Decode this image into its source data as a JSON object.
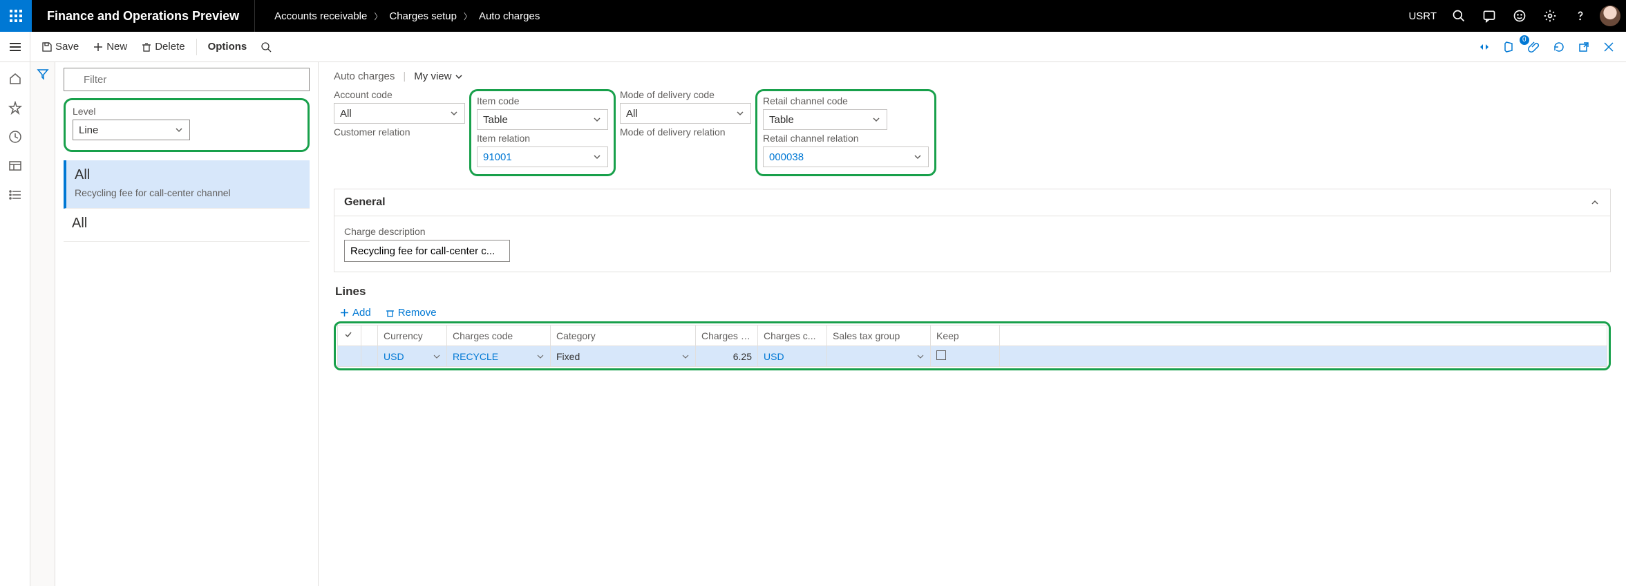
{
  "topbar": {
    "title": "Finance and Operations Preview",
    "breadcrumbs": [
      "Accounts receivable",
      "Charges setup",
      "Auto charges"
    ],
    "company": "USRT"
  },
  "cmdbar": {
    "save": "Save",
    "new": "New",
    "delete": "Delete",
    "options": "Options"
  },
  "nav": {
    "filter_placeholder": "Filter",
    "level_label": "Level",
    "level_value": "Line",
    "items": [
      {
        "title": "All",
        "subtitle": "Recycling fee for call-center channel",
        "selected": true
      },
      {
        "title": "All",
        "subtitle": "",
        "selected": false
      }
    ]
  },
  "main": {
    "heading": "Auto charges",
    "view": "My view",
    "fields": {
      "account_code": {
        "label": "Account code",
        "value": "All"
      },
      "customer_relation": {
        "label": "Customer relation",
        "value": ""
      },
      "item_code": {
        "label": "Item code",
        "value": "Table"
      },
      "item_relation": {
        "label": "Item relation",
        "value": "91001"
      },
      "delivery_code": {
        "label": "Mode of delivery code",
        "value": "All"
      },
      "delivery_relation": {
        "label": "Mode of delivery relation",
        "value": ""
      },
      "retail_code": {
        "label": "Retail channel code",
        "value": "Table"
      },
      "retail_relation": {
        "label": "Retail channel relation",
        "value": "000038"
      }
    },
    "general": {
      "title": "General",
      "charge_desc_label": "Charge description",
      "charge_desc_value": "Recycling fee for call-center c..."
    },
    "lines": {
      "title": "Lines",
      "add": "Add",
      "remove": "Remove",
      "columns": [
        "Currency",
        "Charges code",
        "Category",
        "Charges v...",
        "Charges c...",
        "Sales tax group",
        "Keep"
      ],
      "rows": [
        {
          "currency": "USD",
          "code": "RECYCLE",
          "category": "Fixed",
          "value": "6.25",
          "chg_curr": "USD",
          "tax": "",
          "keep": false
        }
      ]
    }
  },
  "badge": "0"
}
